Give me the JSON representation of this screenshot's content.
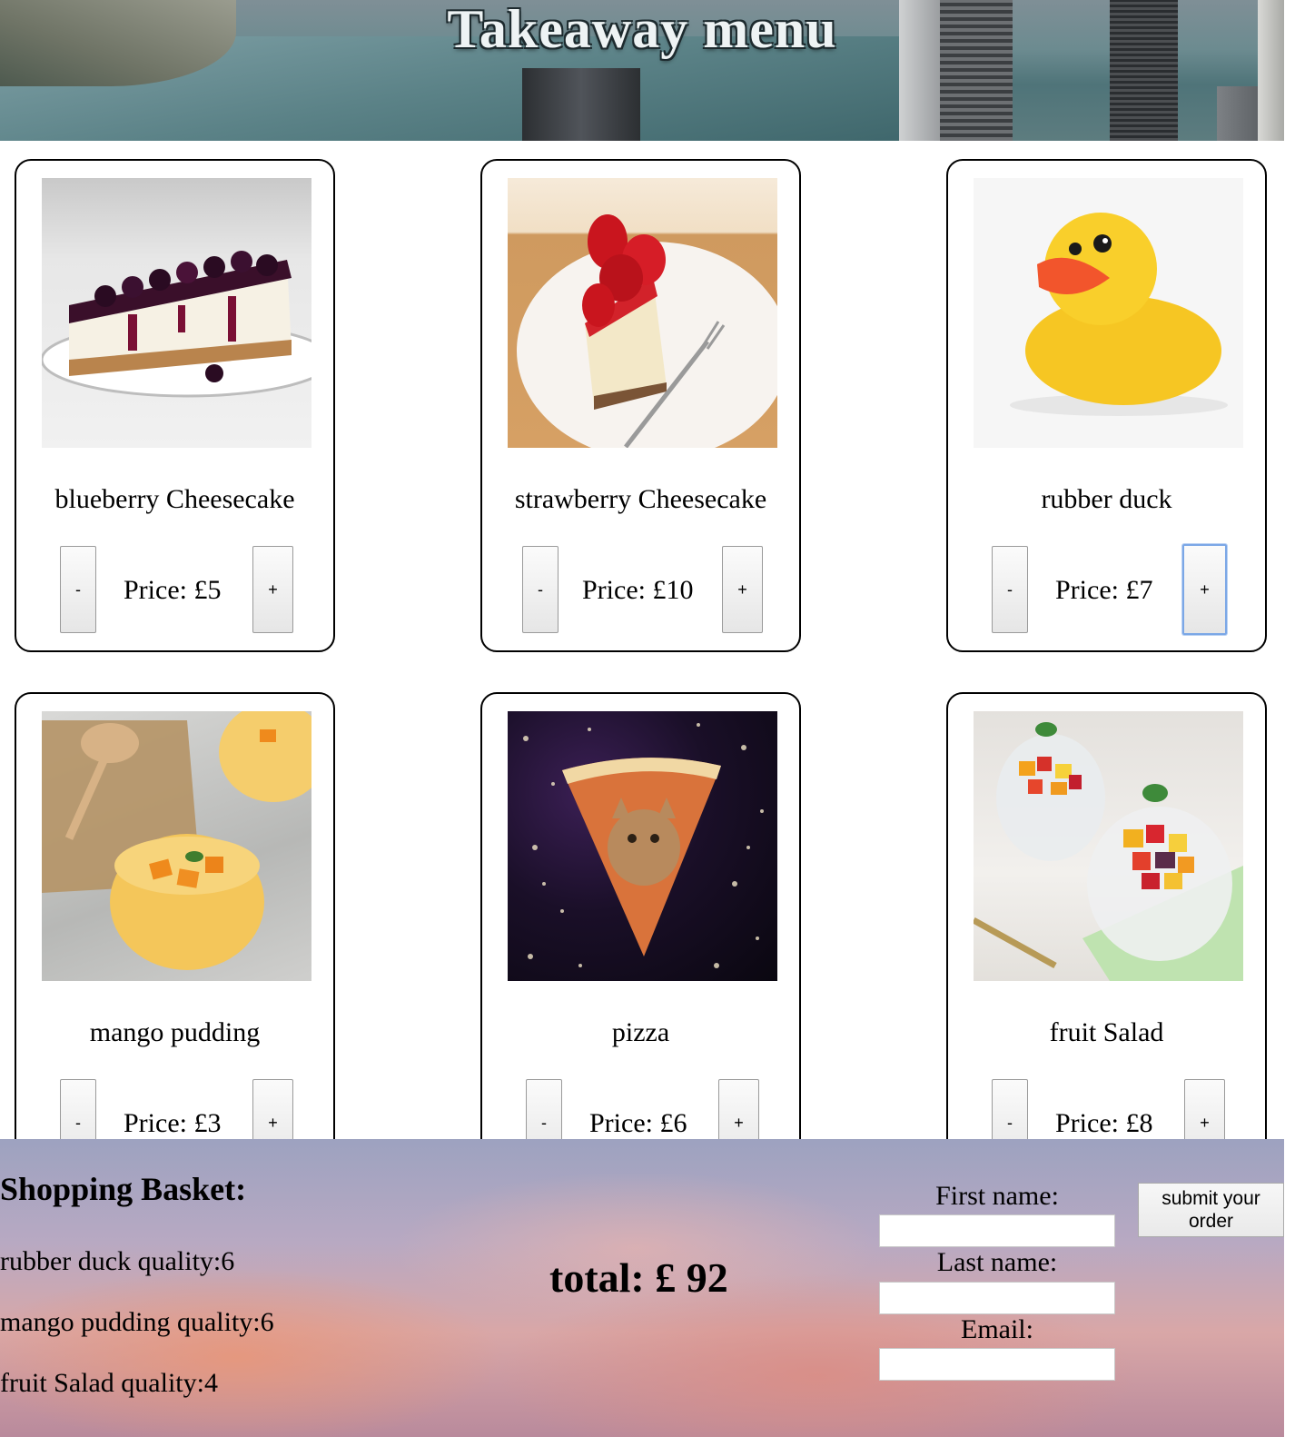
{
  "header": {
    "title": "Takeaway menu"
  },
  "menu": {
    "items": [
      {
        "name": "blueberry Cheesecake",
        "price": "Price: £5",
        "minus": "-",
        "plus": "+"
      },
      {
        "name": "strawberry Cheesecake",
        "price": "Price: £10",
        "minus": "-",
        "plus": "+"
      },
      {
        "name": "rubber duck",
        "price": "Price: £7",
        "minus": "-",
        "plus": "+"
      },
      {
        "name": "mango pudding",
        "price": "Price: £3",
        "minus": "-",
        "plus": "+"
      },
      {
        "name": "pizza",
        "price": "Price: £6",
        "minus": "-",
        "plus": "+"
      },
      {
        "name": "fruit Salad",
        "price": "Price: £8",
        "minus": "-",
        "plus": "+"
      }
    ]
  },
  "basket": {
    "title": "Shopping Basket:",
    "lines": [
      "rubber duck quality:6",
      "mango pudding quality:6",
      "fruit Salad quality:4"
    ],
    "total": "total: £ 92"
  },
  "order_form": {
    "first_name_label": "First name:",
    "first_name_value": "",
    "last_name_label": "Last name:",
    "last_name_value": "",
    "email_label": "Email:",
    "email_value": "",
    "submit_label": "submit your order"
  },
  "colors": {
    "focus_ring": "#7ba7e6",
    "card_border": "#000000"
  }
}
